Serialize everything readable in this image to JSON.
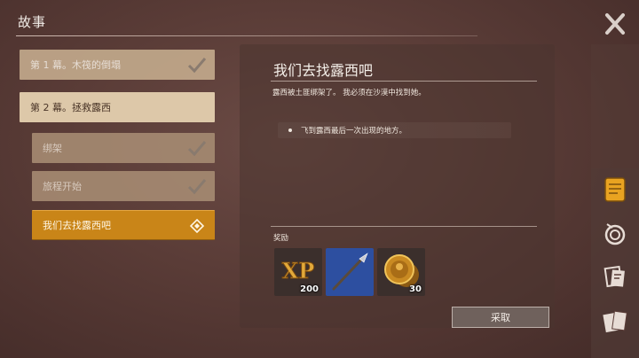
{
  "header": {
    "title": "故事"
  },
  "chapters": [
    {
      "label": "第 1 幕。木筏的倒塌",
      "state": "done"
    },
    {
      "label": "第 2 幕。拯救露西",
      "state": "open"
    },
    {
      "label": "绑架",
      "state": "done"
    },
    {
      "label": "旅程开始",
      "state": "done"
    },
    {
      "label": "我们去找露西吧",
      "state": "active"
    }
  ],
  "quest": {
    "title": "我们去找露西吧",
    "description": "露西被土匪绑架了。 我必须在沙漠中找到她。",
    "objective": "飞到露西最后一次出现的地方。",
    "rewards_label": "奖励",
    "rewards": [
      {
        "icon": "xp-icon",
        "text": "XP",
        "count": "200"
      },
      {
        "icon": "spear-icon",
        "count": ""
      },
      {
        "icon": "gold-coins-icon",
        "count": "30"
      }
    ],
    "claim_label": "采取"
  },
  "side_tabs": [
    "scroll-tab-icon",
    "rope-tab-icon",
    "notes-tab-icon",
    "cards-tab-icon"
  ],
  "colors": {
    "accent": "#c98518",
    "panel": "#5a3c37"
  }
}
